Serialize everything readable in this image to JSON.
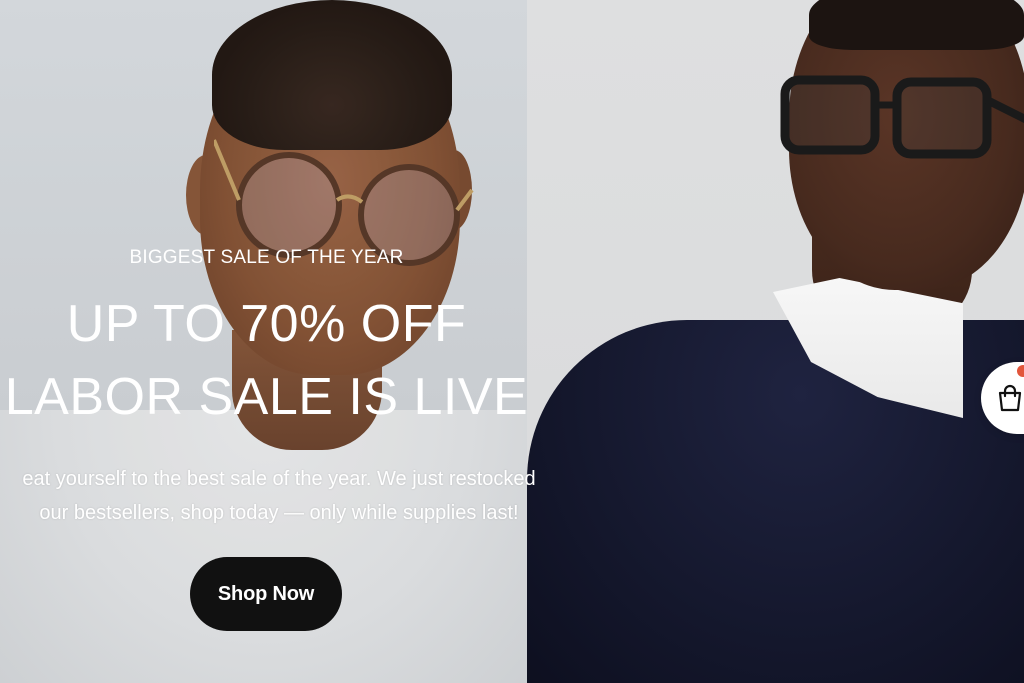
{
  "hero": {
    "eyebrow": "BIGGEST SALE OF THE YEAR",
    "headline_line1": "UP TO 70% OFF",
    "headline_line2": "LABOR SALE IS LIVE",
    "subcopy_line1": "eat yourself to the best sale of the year. We just restocked",
    "subcopy_line2": "our bestsellers, shop today — only while supplies last!",
    "cta_label": "Shop Now"
  },
  "cart": {
    "icon": "shopping-bag-icon"
  },
  "colors": {
    "cta_background": "#111111",
    "text": "#ffffff",
    "badge": "#e2553b"
  }
}
